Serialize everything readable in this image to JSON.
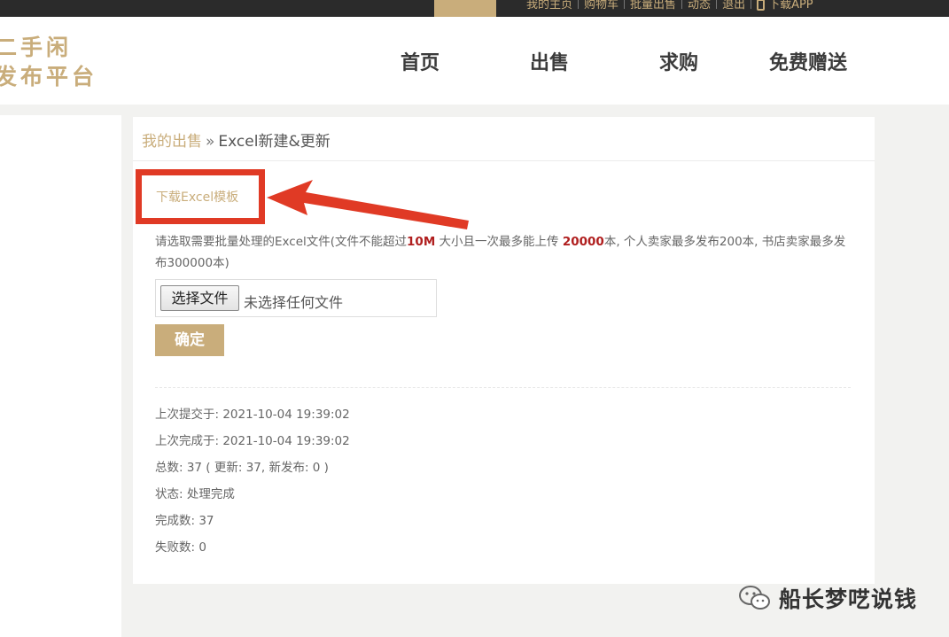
{
  "topbar": {
    "links": [
      "我的主页",
      "购物车",
      "批量出售",
      "动态",
      "退出",
      "下载APP"
    ]
  },
  "logo": {
    "line1": "二手闲",
    "line2": "发布平台"
  },
  "nav": {
    "items": [
      "首页",
      "出售",
      "求购",
      "免费赠送"
    ]
  },
  "breadcrumb": {
    "parent": "我的出售",
    "separator": "»",
    "current": "Excel新建&更新"
  },
  "download": {
    "label": "下载Excel模板"
  },
  "instructions": {
    "part1": "请选取需要批量处理的Excel文件(文件不能超过",
    "size_limit": "10M",
    "part2": " 大小且一次最多能上传 ",
    "count_limit": "20000",
    "part3": "本, 个人卖家最多发布200本, 书店卖家最多发布300000本)"
  },
  "file_input": {
    "button_label": "选择文件",
    "status": "未选择任何文件"
  },
  "submit": {
    "label": "确定"
  },
  "stats": {
    "last_submitted": "上次提交于: 2021-10-04 19:39:02",
    "last_completed": "上次完成于: 2021-10-04 19:39:02",
    "total": "总数: 37 ( 更新: 37, 新发布: 0 )",
    "status": "状态: 处理完成",
    "completed": "完成数: 37",
    "failed": "失败数: 0"
  },
  "watermark": {
    "text": "船长梦呓说钱"
  },
  "colors": {
    "accent": "#c9ad7b",
    "highlight_red": "#e03a25",
    "emphasis": "#b01f1f",
    "topbar": "#2b2b2b"
  },
  "icons": {
    "phone": "phone-icon",
    "arrow": "red-arrow-annotation",
    "wechat": "wechat-icon"
  }
}
